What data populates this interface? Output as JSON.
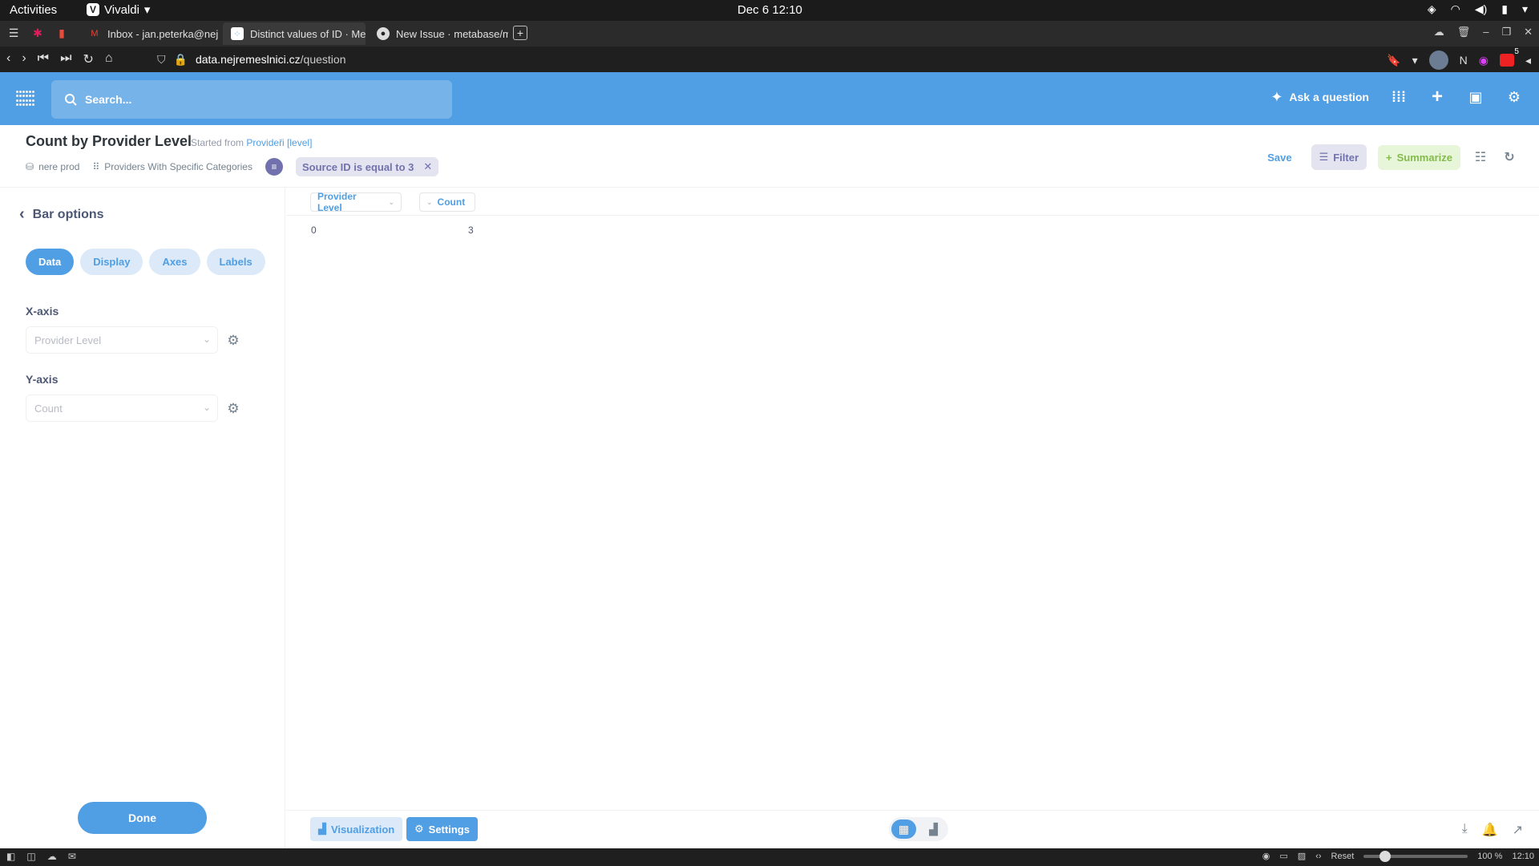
{
  "os": {
    "activities": "Activities",
    "app_name": "Vivaldi",
    "clock": "Dec 6  12:10"
  },
  "browser": {
    "tabs": [
      {
        "title": "Inbox - jan.peterka@nejrem",
        "favicon": "gmail-icon"
      },
      {
        "title": "Distinct values of ID · Meta",
        "favicon": "metabase-icon"
      },
      {
        "title": "New Issue · metabase/met",
        "favicon": "github-icon"
      }
    ],
    "url_host": "data.nejremeslnici.cz",
    "url_path": "/question",
    "extension_badge": "5"
  },
  "nav": {
    "search_placeholder": "Search...",
    "ask_question": "Ask a question"
  },
  "question": {
    "title": "Count by Provider Level",
    "started_from_label": "Started from",
    "started_from_link": "Provideři [level]",
    "database": "nere prod",
    "table": "Providers With Specific Categories",
    "filter_pill": "Source ID is equal to 3",
    "actions": {
      "save": "Save",
      "filter": "Filter",
      "summarize": "Summarize"
    }
  },
  "sidebar": {
    "back_title": "Bar options",
    "tabs": [
      "Data",
      "Display",
      "Axes",
      "Labels"
    ],
    "active_tab": "Data",
    "x_axis_label": "X-axis",
    "x_axis_value": "Provider Level",
    "y_axis_label": "Y-axis",
    "y_axis_value": "Count",
    "done": "Done"
  },
  "table": {
    "columns": [
      "Provider Level",
      "Count"
    ],
    "rows": [
      [
        "0",
        "3"
      ]
    ]
  },
  "footer": {
    "visualization": "Visualization",
    "settings": "Settings"
  },
  "statusbar": {
    "reset": "Reset",
    "zoom": "100 %",
    "time": "12:10"
  },
  "colors": {
    "brand": "#509ee3",
    "filter": "#7172ad",
    "summarize": "#84bb4c"
  }
}
